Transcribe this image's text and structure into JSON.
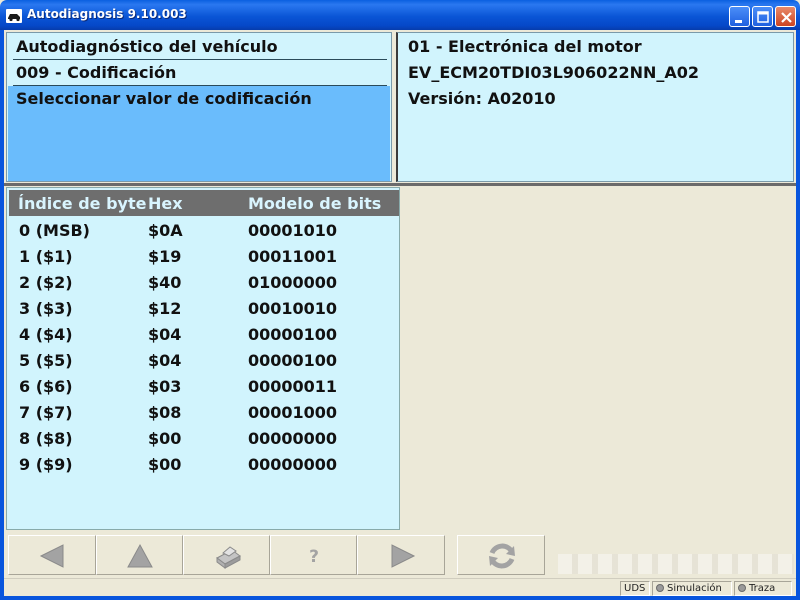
{
  "window": {
    "title": "Autodiagnosis 9.10.003",
    "icon": "car-icon",
    "controls": [
      "minimize",
      "maximize",
      "close"
    ]
  },
  "left_panel": {
    "line1": "Autodiagnóstico del vehículo",
    "line2": "009 - Codificación",
    "selected": "Seleccionar valor de codificación"
  },
  "right_panel": {
    "line1": "01 - Electrónica del motor",
    "line2": "EV_ECM20TDI03L906022NN_A02",
    "line3": "Versión: A02010"
  },
  "table": {
    "headers": {
      "index": "Índice de byte",
      "hex": "Hex",
      "bits": "Modelo de bits"
    },
    "rows": [
      {
        "index": "0  (MSB)",
        "hex": "$0A",
        "bits": "00001010"
      },
      {
        "index": "1  ($1)",
        "hex": "$19",
        "bits": "00011001"
      },
      {
        "index": "2  ($2)",
        "hex": "$40",
        "bits": "01000000"
      },
      {
        "index": "3  ($3)",
        "hex": "$12",
        "bits": "00010010"
      },
      {
        "index": "4  ($4)",
        "hex": "$04",
        "bits": "00000100"
      },
      {
        "index": "5  ($5)",
        "hex": "$04",
        "bits": "00000100"
      },
      {
        "index": "6  ($6)",
        "hex": "$03",
        "bits": "00000011"
      },
      {
        "index": "7  ($7)",
        "hex": "$08",
        "bits": "00001000"
      },
      {
        "index": "8  ($8)",
        "hex": "$00",
        "bits": "00000000"
      },
      {
        "index": "9  ($9)",
        "hex": "$00",
        "bits": "00000000"
      }
    ]
  },
  "toolbar": {
    "buttons": [
      "back-arrow-icon",
      "up-arrow-icon",
      "print-icon",
      "help-icon",
      "forward-arrow-icon",
      "refresh-icon"
    ]
  },
  "statusbar": {
    "protocol": "UDS",
    "simulation": "Simulación",
    "trace": "Traza"
  },
  "colors": {
    "panel_bg": "#d1f4fd",
    "selected_bg": "#6abcfc",
    "header_bg": "#6e6e6e",
    "header_text": "#d9f5ff",
    "titlebar": "#0a55d6"
  }
}
